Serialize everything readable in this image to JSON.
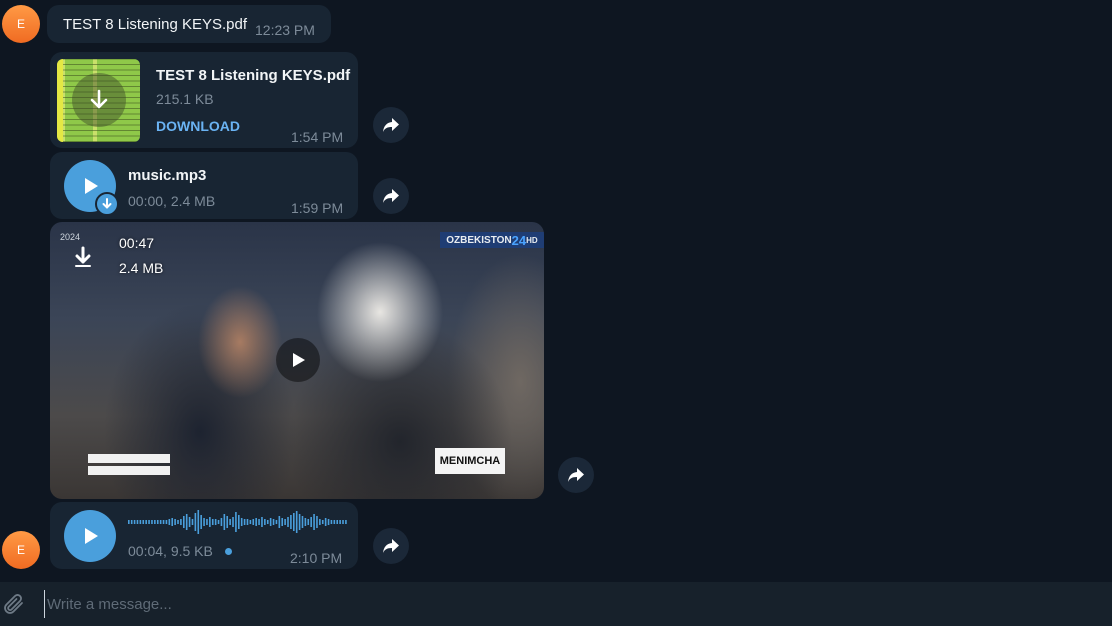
{
  "messages": {
    "pdf_text": {
      "avatar_letter": "E",
      "text": "TEST 8 Listening KEYS.pdf",
      "time": "12:23 PM"
    },
    "pdf_file": {
      "filename": "TEST 8 Listening KEYS.pdf",
      "size": "215.1 KB",
      "action": "DOWNLOAD",
      "time": "1:54 PM"
    },
    "audio_file": {
      "filename": "music.mp3",
      "info": "00:00, 2.4 MB",
      "time": "1:59 PM"
    },
    "video": {
      "duration": "00:47",
      "size": "2.4 MB",
      "overlay_date": "2024",
      "channel_logo": "OZBEKISTON",
      "channel_logo_num": "24",
      "channel_logo_suffix": "HD",
      "lower_caption": "MENIMCHA"
    },
    "voice": {
      "avatar_letter": "E",
      "info": "00:04, 9.5 KB",
      "time": "2:10 PM"
    }
  },
  "composer": {
    "placeholder": "Write a message..."
  },
  "icons": {
    "forward": "forward-arrow-icon",
    "play": "play-icon",
    "download": "download-arrow-icon",
    "attach": "paperclip-icon"
  },
  "colors": {
    "background": "#0e1621",
    "bubble": "#182533",
    "accent": "#4a9fdc",
    "link": "#6ab3f3",
    "avatar": "#f07a2c",
    "muted": "#7d8b99"
  }
}
